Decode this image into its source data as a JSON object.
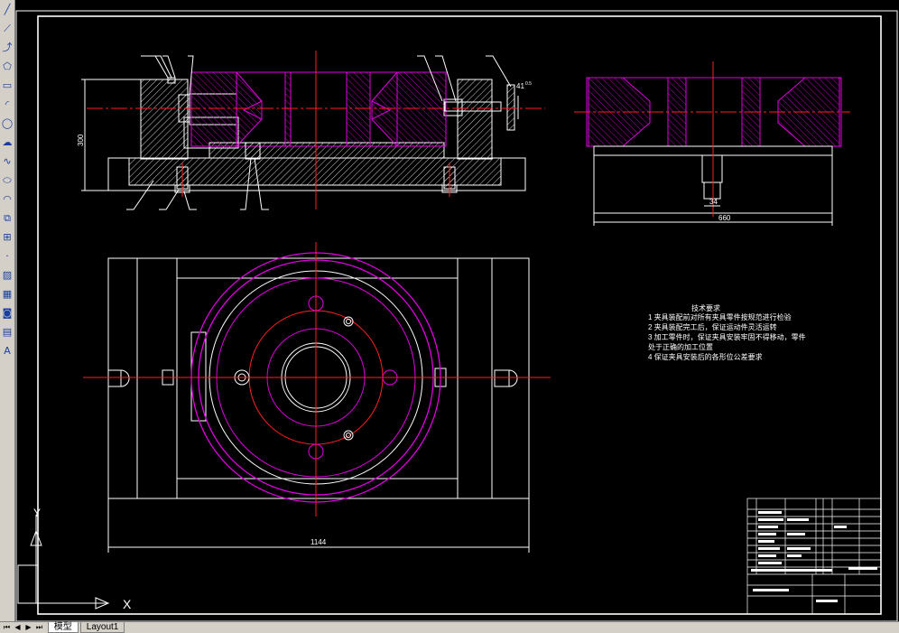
{
  "toolbar": {
    "tools": [
      {
        "name": "line-tool",
        "glyph": "╱"
      },
      {
        "name": "construction-line-tool",
        "glyph": "⟋"
      },
      {
        "name": "polyline-tool",
        "glyph": "⤴"
      },
      {
        "name": "polygon-tool",
        "glyph": "⬠"
      },
      {
        "name": "rectangle-tool",
        "glyph": "▭"
      },
      {
        "name": "arc-tool",
        "glyph": "◜"
      },
      {
        "name": "circle-tool",
        "glyph": "◯"
      },
      {
        "name": "revision-cloud-tool",
        "glyph": "☁"
      },
      {
        "name": "spline-tool",
        "glyph": "∿"
      },
      {
        "name": "ellipse-tool",
        "glyph": "⬭"
      },
      {
        "name": "ellipse-arc-tool",
        "glyph": "◠"
      },
      {
        "name": "insert-block-tool",
        "glyph": "⧉"
      },
      {
        "name": "make-block-tool",
        "glyph": "⊞"
      },
      {
        "name": "point-tool",
        "glyph": "·"
      },
      {
        "name": "hatch-tool",
        "glyph": "▨"
      },
      {
        "name": "gradient-tool",
        "glyph": "▦"
      },
      {
        "name": "region-tool",
        "glyph": "◙"
      },
      {
        "name": "table-tool",
        "glyph": "▤"
      },
      {
        "name": "text-tool",
        "glyph": "A"
      }
    ]
  },
  "drawing": {
    "dim_height": "300",
    "dim_side_height": "41",
    "dim_side_height_sub": "0.5",
    "dim_width_plan": "1144",
    "dim_width_side": "660",
    "dim_small": "34",
    "tech_title": "技术要求",
    "tech_lines": [
      "1  夹具装配前对所有夹具零件按规范进行检验",
      "2  夹具装配完工后，保证运动件灵活运转",
      "3  加工零件时，保证夹具安装牢固不得移动，零件",
      "    处于正确的加工位置",
      "4  保证夹具安装后的各形位公差要求"
    ],
    "ucs_x": "X",
    "ucs_y": "Y"
  },
  "tabs": {
    "model": "模型",
    "layout1": "Layout1"
  }
}
